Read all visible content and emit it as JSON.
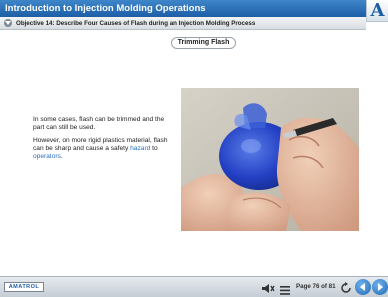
{
  "header": {
    "title": "Introduction to Injection Molding Operations",
    "logo_letter": "A"
  },
  "objective": {
    "text": "Objective 14: Describe Four Causes of Flash during an Injection Molding Process"
  },
  "slide": {
    "title": "Trimming Flash",
    "paragraph1": "In some cases, flash can be trimmed and the part can still be used.",
    "paragraph2_start": "However, on more rigid plastics material, flash can be sharp and cause a safety ",
    "link1": "hazard",
    "paragraph2_mid": " to ",
    "link2": "operators",
    "paragraph2_end": "."
  },
  "footer": {
    "brand": "AMATROL",
    "page_label": "Page 76 of 81"
  },
  "colors": {
    "title_bar": "#1d5ea6",
    "link": "#2a6fbb",
    "nav_button": "#1f67b3"
  },
  "icons": [
    "chevron-down-icon",
    "mute-icon",
    "menu-icon",
    "reload-icon",
    "back-arrow-icon",
    "next-arrow-icon"
  ]
}
